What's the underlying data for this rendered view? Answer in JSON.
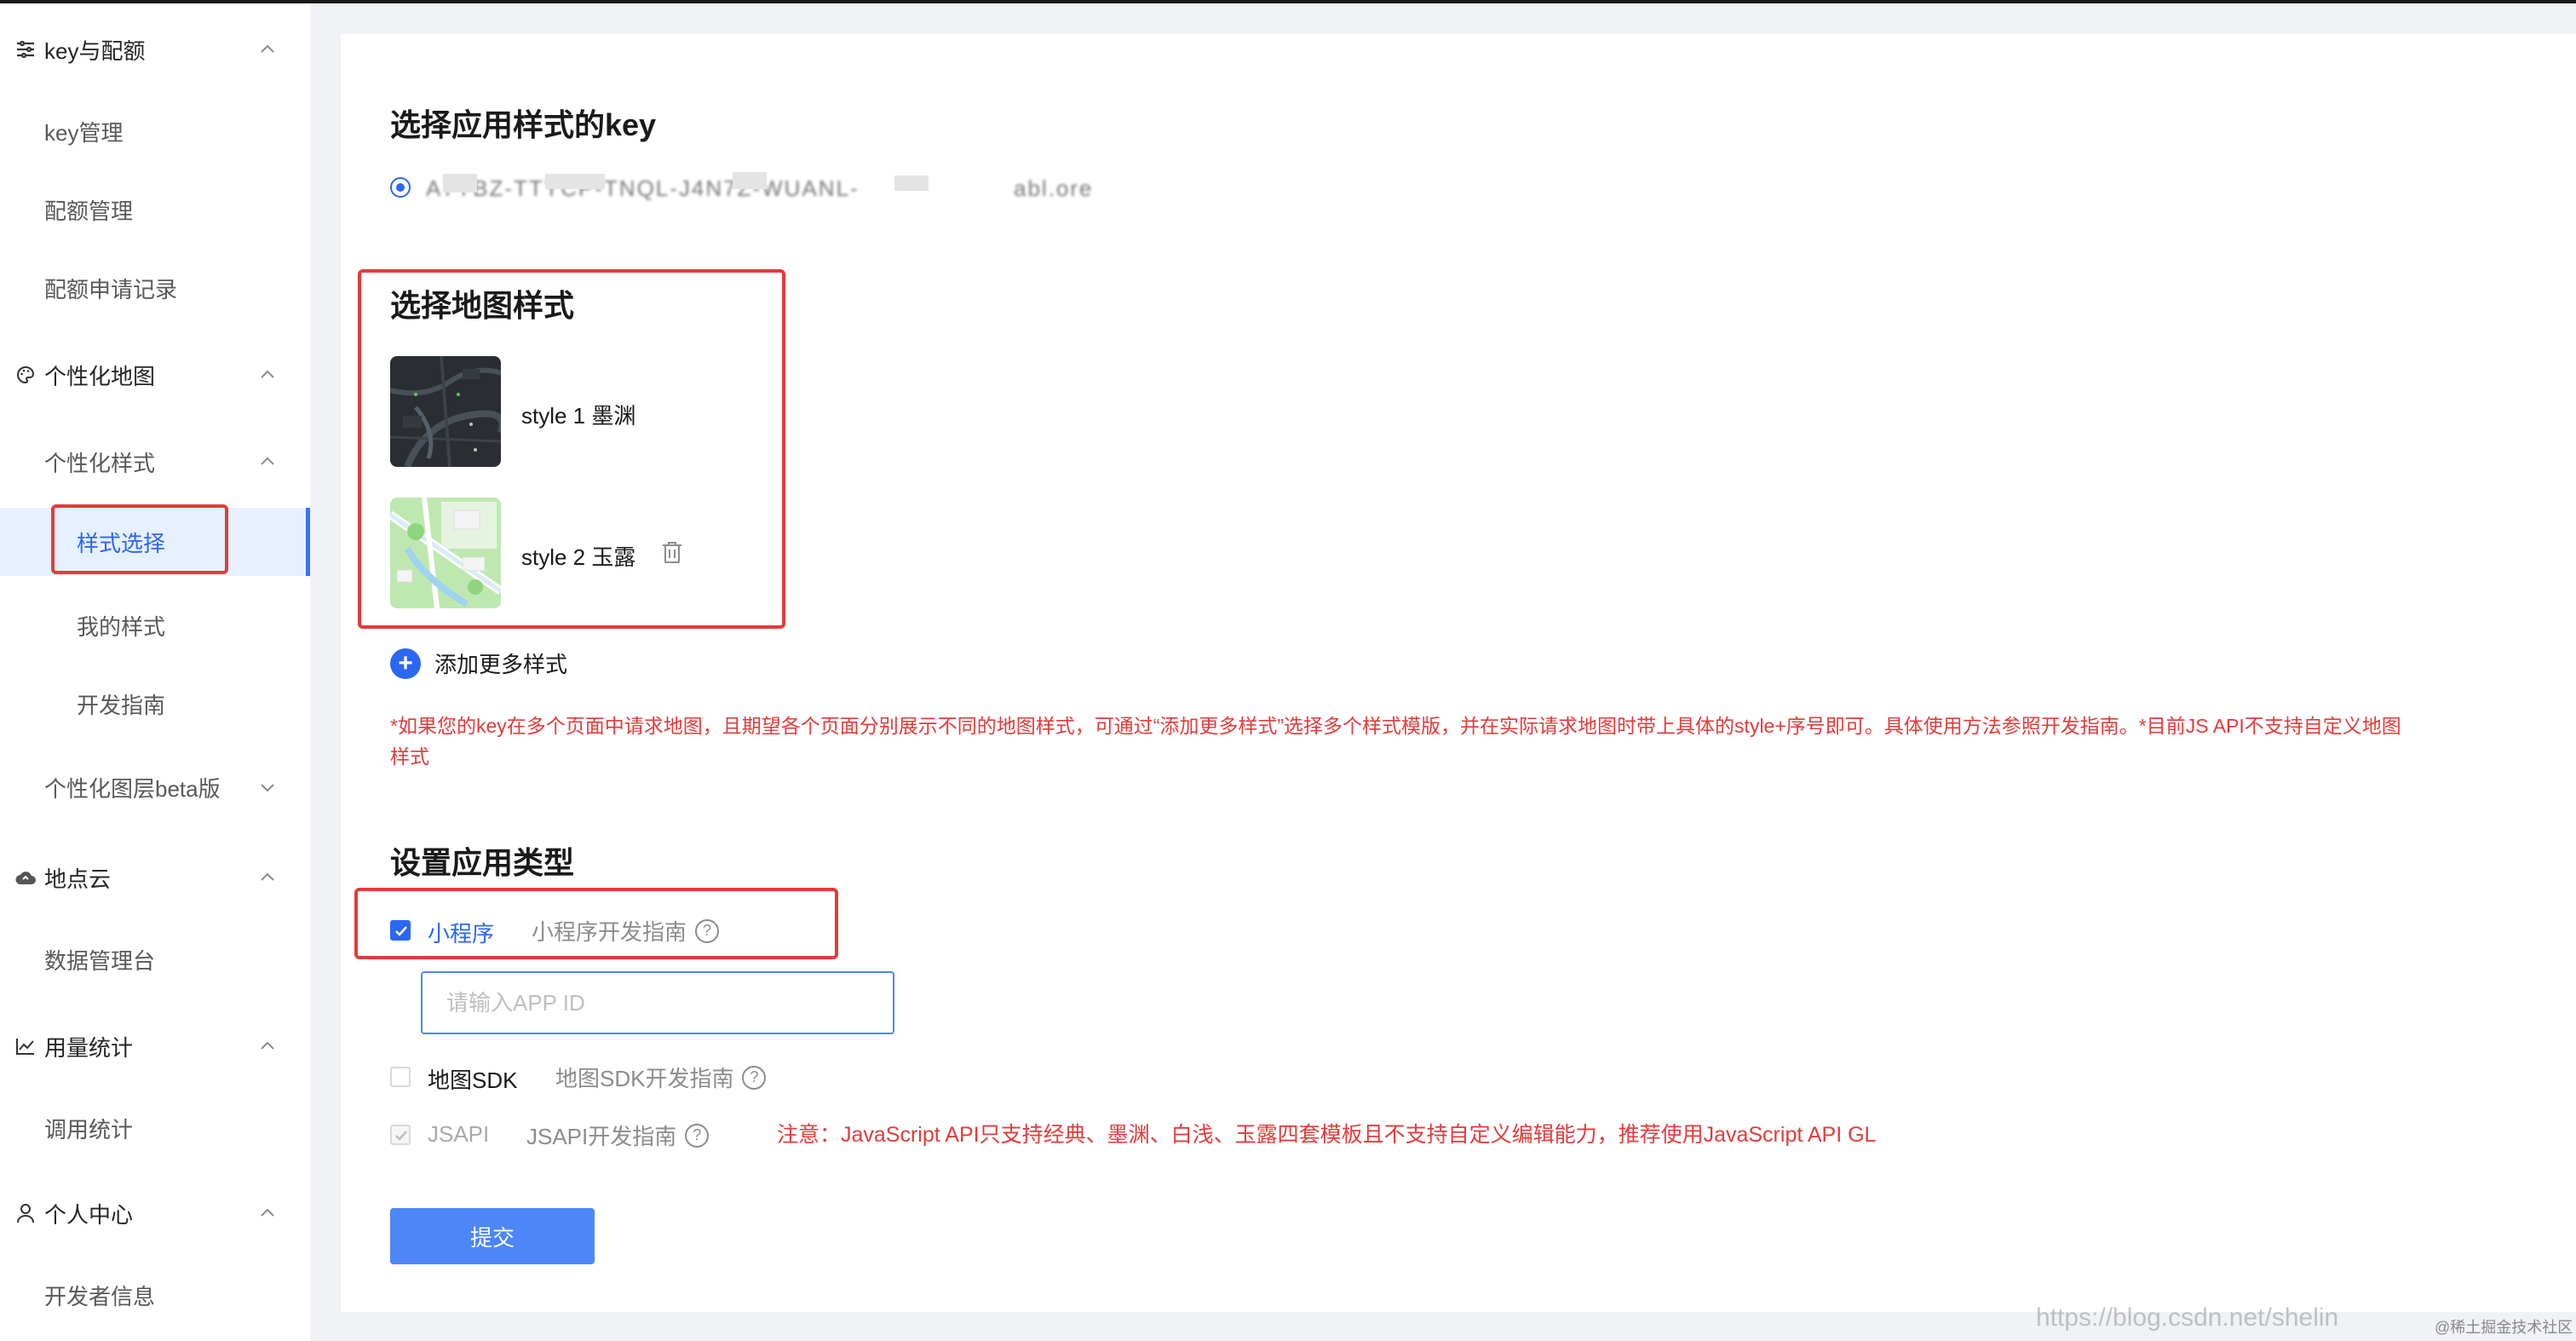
{
  "sidebar": {
    "groups": [
      {
        "label": "key与配额",
        "icon": "list-icon"
      },
      {
        "label": "个性化地图",
        "icon": "palette-icon"
      },
      {
        "label": "地点云",
        "icon": "cloud-icon"
      },
      {
        "label": "用量统计",
        "icon": "chart-icon"
      },
      {
        "label": "个人中心",
        "icon": "user-icon"
      }
    ],
    "items": {
      "key_manage": "key管理",
      "quota_manage": "配额管理",
      "quota_records": "配额申请记录",
      "custom_style": "个性化样式",
      "style_select": "样式选择",
      "my_styles": "我的样式",
      "dev_guide": "开发指南",
      "custom_layer": "个性化图层beta版",
      "data_console": "数据管理台",
      "call_stats": "调用统计",
      "dev_info": "开发者信息"
    }
  },
  "main": {
    "key_section": {
      "title": "选择应用样式的key",
      "key_value": "A7YBZ-TTYCP-TNQL-J4N7Z-WUANL-TLBOO",
      "key_suffix": "abl.ore"
    },
    "style_section": {
      "title": "选择地图样式",
      "styles": [
        {
          "label": "style 1 墨渊",
          "icon": "dark-map-thumbnail"
        },
        {
          "label": "style 2 玉露",
          "icon": "light-map-thumbnail"
        }
      ],
      "add_more": "添加更多样式",
      "note_line1": "*如果您的key在多个页面中请求地图，且期望各个页面分别展示不同的地图样式，可通过“添加更多样式”选择多个样式模版，并在实际请求地图时带上具体的style+序号即可。具体使用方法参照开发指南。*目前JS API不支持自定义地图",
      "note_line2": "样式"
    },
    "app_type_section": {
      "title": "设置应用类型",
      "miniprogram": {
        "label": "小程序",
        "guide": "小程序开发指南",
        "checked": true
      },
      "app_id_placeholder": "请输入APP ID",
      "map_sdk": {
        "label": "地图SDK",
        "guide": "地图SDK开发指南",
        "checked": false
      },
      "jsapi": {
        "label": "JSAPI",
        "guide": "JSAPI开发指南",
        "checked": true,
        "disabled": true
      },
      "jsapi_note": "注意：JavaScript API只支持经典、墨渊、白浅、玉露四套模板且不支持自定义编辑能力，推荐使用JavaScript API GL"
    },
    "submit_label": "提交"
  },
  "watermark": {
    "url": "https://blog.csdn.net/shelin",
    "site": "@稀土掘金技术社区"
  },
  "colors": {
    "accent": "#2b66f5",
    "annotation_red": "#e33b3b",
    "active_bg": "#e6f0ff",
    "page_bg": "#f0f2f5"
  }
}
